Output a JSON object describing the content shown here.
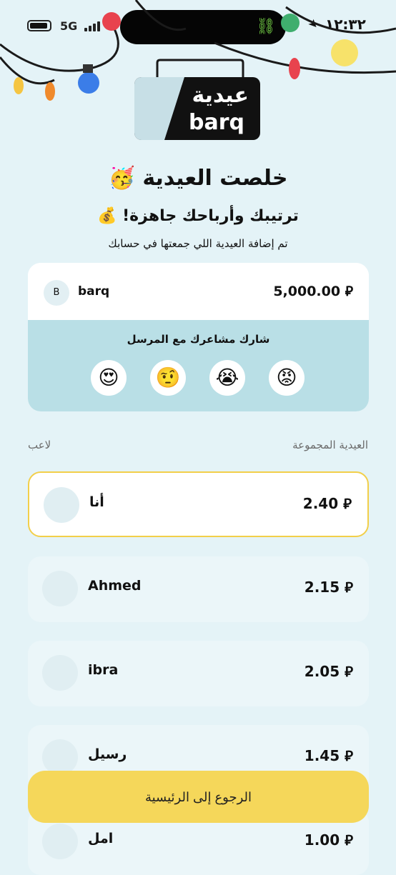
{
  "status_bar": {
    "network": "5G",
    "time": "١٢:٣٢"
  },
  "logo": {
    "arabic": "عيدية",
    "latin": "barq"
  },
  "header": {
    "title": "خلصت العيدية 🥳",
    "subtitle": "ترتيبك وأرباحك جاهزة! 💰",
    "description": "تم إضافة العيدية اللي جمعتها في حسابك"
  },
  "sender_card": {
    "avatar_letter": "B",
    "name": "barq",
    "amount": "5,000.00 ⃁",
    "share_label": "شارك مشاعرك مع المرسل",
    "reactions": [
      "😍",
      "🤨",
      "😭",
      "😡"
    ]
  },
  "list_header": {
    "right_label": "العيدية المجموعة",
    "left_label": "لاعب"
  },
  "players": [
    {
      "name": "أنا",
      "amount": "2.40 ⃁"
    },
    {
      "name": "Ahmed",
      "amount": "2.15 ⃁"
    },
    {
      "name": "ibra",
      "amount": "2.05 ⃁"
    },
    {
      "name": "رسيل",
      "amount": "1.45 ⃁"
    },
    {
      "name": "امل",
      "amount": "1.00 ⃁"
    }
  ],
  "home_button": {
    "label": "الرجوع إلى الرئيسية"
  }
}
